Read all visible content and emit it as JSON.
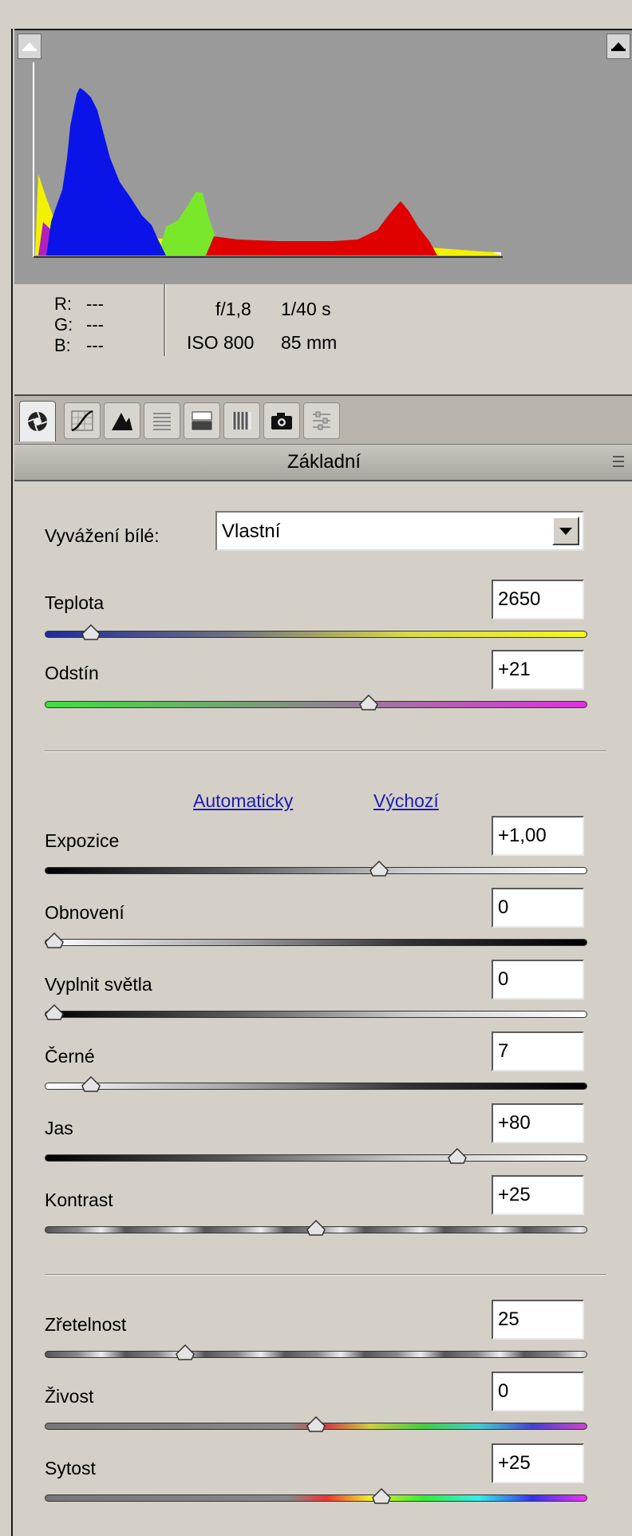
{
  "histogram": {
    "clip_left_icon": "shadow-clipping-warning-icon",
    "clip_right_icon": "highlight-clipping-warning-icon"
  },
  "info": {
    "r_label": "R:",
    "r_value": "---",
    "g_label": "G:",
    "g_value": "---",
    "b_label": "B:",
    "b_value": "---",
    "aperture": "f/1,8",
    "shutter": "1/40 s",
    "iso": "ISO 800",
    "focal": "85 mm"
  },
  "tabs": [
    {
      "icon": "basic-aperture-icon",
      "active": true
    },
    {
      "icon": "tone-curve-icon",
      "active": false
    },
    {
      "icon": "detail-icon",
      "active": false
    },
    {
      "icon": "hsl-grayscale-icon",
      "active": false
    },
    {
      "icon": "split-toning-icon",
      "active": false
    },
    {
      "icon": "lens-corrections-icon",
      "active": false
    },
    {
      "icon": "camera-calibration-icon",
      "active": false
    },
    {
      "icon": "presets-icon",
      "active": false
    }
  ],
  "section": {
    "title": "Základní",
    "menu_icon": "panel-menu-icon"
  },
  "white_balance": {
    "label": "Vyvážení bílé:",
    "value": "Vlastní"
  },
  "links": {
    "auto": "Automaticky",
    "default": "Výchozí"
  },
  "sliders": {
    "temperature": {
      "label": "Teplota",
      "value": "2650",
      "level": 0.07
    },
    "tint": {
      "label": "Odstín",
      "value": "+21",
      "level": 0.6
    },
    "exposure": {
      "label": "Expozice",
      "value": "+1,00",
      "level": 0.62
    },
    "recovery": {
      "label": "Obnovení",
      "value": "0",
      "level": 0.0
    },
    "fill_light": {
      "label": "Vyplnit světla",
      "value": "0",
      "level": 0.0
    },
    "blacks": {
      "label": "Černé",
      "value": "7",
      "level": 0.07
    },
    "brightness": {
      "label": "Jas",
      "value": "+80",
      "level": 0.77
    },
    "contrast": {
      "label": "Kontrast",
      "value": "+25",
      "level": 0.5
    },
    "clarity": {
      "label": "Zřetelnost",
      "value": "25",
      "level": 0.25
    },
    "vibrance": {
      "label": "Živost",
      "value": "0",
      "level": 0.5
    },
    "saturation": {
      "label": "Sytost",
      "value": "+25",
      "level": 0.625
    }
  }
}
